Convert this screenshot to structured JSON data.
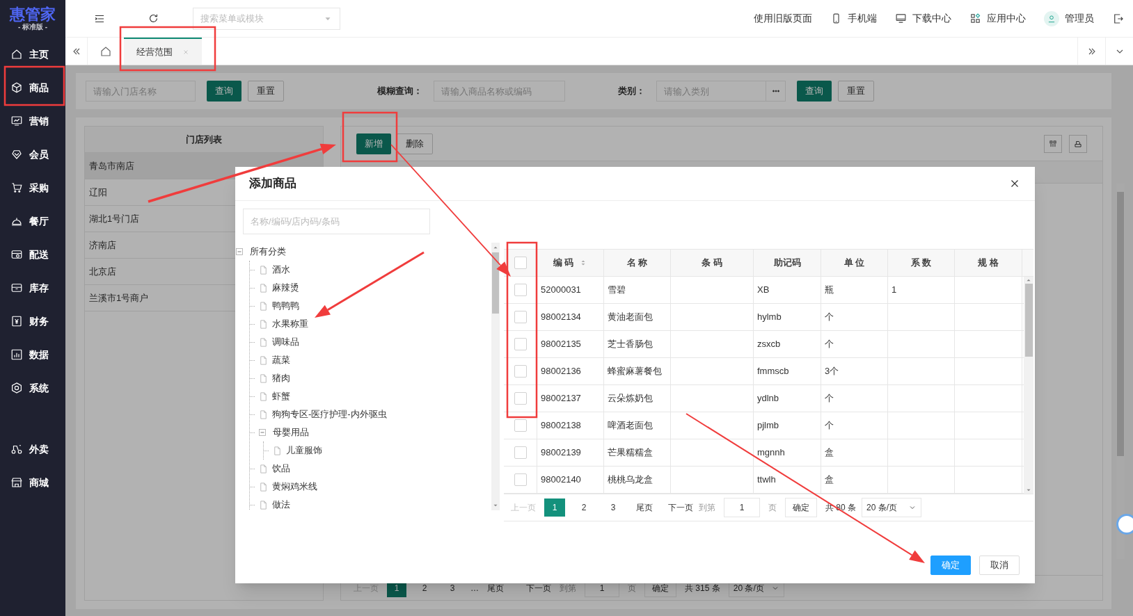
{
  "sidebar": {
    "logo": "惠管家",
    "edition": "- 标准版 -",
    "items": [
      {
        "label": "主页"
      },
      {
        "label": "商品"
      },
      {
        "label": "营销"
      },
      {
        "label": "会员"
      },
      {
        "label": "采购"
      },
      {
        "label": "餐厅"
      },
      {
        "label": "配送"
      },
      {
        "label": "库存"
      },
      {
        "label": "财务"
      },
      {
        "label": "数据"
      },
      {
        "label": "系统"
      }
    ],
    "extra_items": [
      {
        "label": "外卖"
      },
      {
        "label": "商城"
      }
    ]
  },
  "topbar": {
    "search_placeholder": "搜索菜单或模块",
    "old_page_link": "使用旧版页面",
    "links": [
      "手机端",
      "下载中心",
      "应用中心"
    ],
    "user": "管理员"
  },
  "page_tabs": [
    {
      "label": "经营范围",
      "selected": true
    }
  ],
  "filters": {
    "store_placeholder": "请输入门店名称",
    "store_buttons": [
      "查询",
      "重置"
    ],
    "fuzzy_label": "模糊查询：",
    "fuzzy_placeholder": "请输入商品名称或编码",
    "category_label": "类别：",
    "category_placeholder": "请输入类别",
    "category_buttons": [
      "查询",
      "重置"
    ]
  },
  "store_list": {
    "title": "门店列表",
    "stores": [
      {
        "name": "青岛市南店",
        "selected": true
      },
      {
        "name": "辽阳",
        "selected": false
      },
      {
        "name": "湖北1号门店",
        "selected": false
      },
      {
        "name": "济南店",
        "selected": false
      },
      {
        "name": "北京店",
        "selected": false
      },
      {
        "name": "兰溪市1号商户",
        "selected": false
      }
    ]
  },
  "toolbar": {
    "buttons": [
      "新增",
      "删除"
    ]
  },
  "page_pagination": {
    "prev": "上一页",
    "pages": [
      {
        "label": "1",
        "selected": true
      },
      {
        "label": "2",
        "selected": false
      },
      {
        "label": "3",
        "selected": false
      }
    ],
    "ellipsis": "…",
    "last": "尾页",
    "next": "下一页",
    "goto_label": "到第",
    "goto_value": "1",
    "page_label": "页",
    "confirm": "确定",
    "total": "共 315 条",
    "page_size": "20 条/页"
  },
  "modal": {
    "title": "添加商品",
    "search_placeholder": "名称/编码/店内码/条码",
    "tree": {
      "label": "所有分类",
      "expanded": true,
      "children": [
        {
          "label": "酒水"
        },
        {
          "label": "麻辣烫"
        },
        {
          "label": "鸭鸭鸭"
        },
        {
          "label": "水果称重"
        },
        {
          "label": "调味品"
        },
        {
          "label": "蔬菜"
        },
        {
          "label": "猪肉"
        },
        {
          "label": "虾蟹"
        },
        {
          "label": "狗狗专区-医疗护理-内外驱虫"
        },
        {
          "label": "母婴用品",
          "expanded": true,
          "children": [
            {
              "label": "儿童服饰"
            }
          ]
        },
        {
          "label": "饮品"
        },
        {
          "label": "黄焖鸡米线"
        },
        {
          "label": "做法"
        }
      ]
    },
    "table": {
      "all_checked": false,
      "columns": [
        {
          "label": "编 码",
          "sortable": true
        },
        {
          "label": "名 称",
          "sortable": false
        },
        {
          "label": "条 码",
          "sortable": false
        },
        {
          "label": "助记码",
          "sortable": false
        },
        {
          "label": "单 位",
          "sortable": false
        },
        {
          "label": "系 数",
          "sortable": false
        },
        {
          "label": "规 格",
          "sortable": false
        }
      ],
      "rows": [
        {
          "checked": false,
          "cells": [
            "52000031",
            "雪碧",
            "",
            "XB",
            "瓶",
            "1",
            ""
          ]
        },
        {
          "checked": false,
          "cells": [
            "98002134",
            "黄油老面包",
            "",
            "hylmb",
            "个",
            "",
            ""
          ]
        },
        {
          "checked": false,
          "cells": [
            "98002135",
            "芝士香肠包",
            "",
            "zsxcb",
            "个",
            "",
            ""
          ]
        },
        {
          "checked": false,
          "cells": [
            "98002136",
            "蜂蜜麻薯餐包",
            "",
            "fmmscb",
            "3个",
            "",
            ""
          ]
        },
        {
          "checked": false,
          "cells": [
            "98002137",
            "云朵炼奶包",
            "",
            "ydlnb",
            "个",
            "",
            ""
          ]
        },
        {
          "checked": false,
          "cells": [
            "98002138",
            "啤酒老面包",
            "",
            "pjlmb",
            "个",
            "",
            ""
          ]
        },
        {
          "checked": false,
          "cells": [
            "98002139",
            "芒果糯糯盒",
            "",
            "mgnnh",
            "盒",
            "",
            ""
          ]
        },
        {
          "checked": false,
          "cells": [
            "98002140",
            "桃桃乌龙盒",
            "",
            "ttwlh",
            "盒",
            "",
            ""
          ]
        }
      ]
    },
    "pagination": {
      "prev": "上一页",
      "prev_disabled": true,
      "pages": [
        {
          "label": "1",
          "selected": true
        },
        {
          "label": "2",
          "selected": false
        },
        {
          "label": "3",
          "selected": false
        }
      ],
      "last": "尾页",
      "next": "下一页",
      "goto_label": "到第",
      "goto_value": "1",
      "page_label": "页",
      "confirm": "确定",
      "total": "共 80 条",
      "page_size": "20 条/页"
    },
    "buttons": [
      {
        "label": "确定",
        "kind": "primary"
      },
      {
        "label": "取消",
        "kind": "default"
      }
    ]
  }
}
